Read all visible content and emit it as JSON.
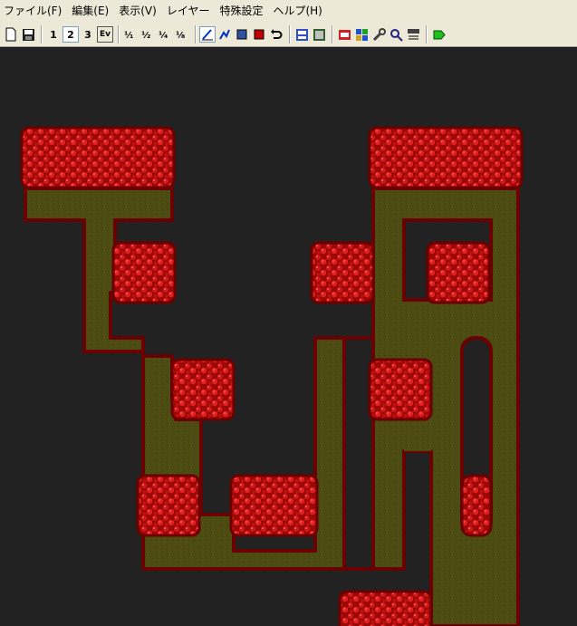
{
  "menu": [
    {
      "label": "ファイル(F)"
    },
    {
      "label": "編集(E)"
    },
    {
      "label": "表示(V)"
    },
    {
      "label": "レイヤー"
    },
    {
      "label": "特殊設定"
    },
    {
      "label": "ヘルプ(H)"
    }
  ],
  "toolbar": {
    "layer_buttons": [
      "1",
      "2",
      "3",
      "Ev"
    ],
    "tools": [
      {
        "icon": "new-file-icon"
      },
      {
        "icon": "save-icon"
      },
      {
        "icon": "layer1-icon"
      },
      {
        "icon": "layer2-icon"
      },
      {
        "icon": "layer3-icon"
      },
      {
        "icon": "event-layer-icon"
      },
      {
        "icon": "scale-1-1-icon"
      },
      {
        "icon": "scale-1-2-icon"
      },
      {
        "icon": "scale-1-4-icon"
      },
      {
        "icon": "scale-1-8-icon"
      },
      {
        "icon": "pencil-icon"
      },
      {
        "icon": "line-icon"
      },
      {
        "icon": "rectangle-icon"
      },
      {
        "icon": "fill-icon"
      },
      {
        "icon": "undo-icon"
      },
      {
        "icon": "database-icon"
      },
      {
        "icon": "game-settings-icon"
      },
      {
        "icon": "sound-icon"
      },
      {
        "icon": "material-icon"
      },
      {
        "icon": "tools-icon"
      },
      {
        "icon": "search-icon"
      },
      {
        "icon": "map-list-icon"
      },
      {
        "icon": "test-play-icon"
      }
    ]
  },
  "colors": {
    "lava": "#b01010",
    "lava_dark": "#6a0000",
    "lava_highlight": "#ff3030",
    "grass": "#4a4a12",
    "void": "#222222"
  }
}
